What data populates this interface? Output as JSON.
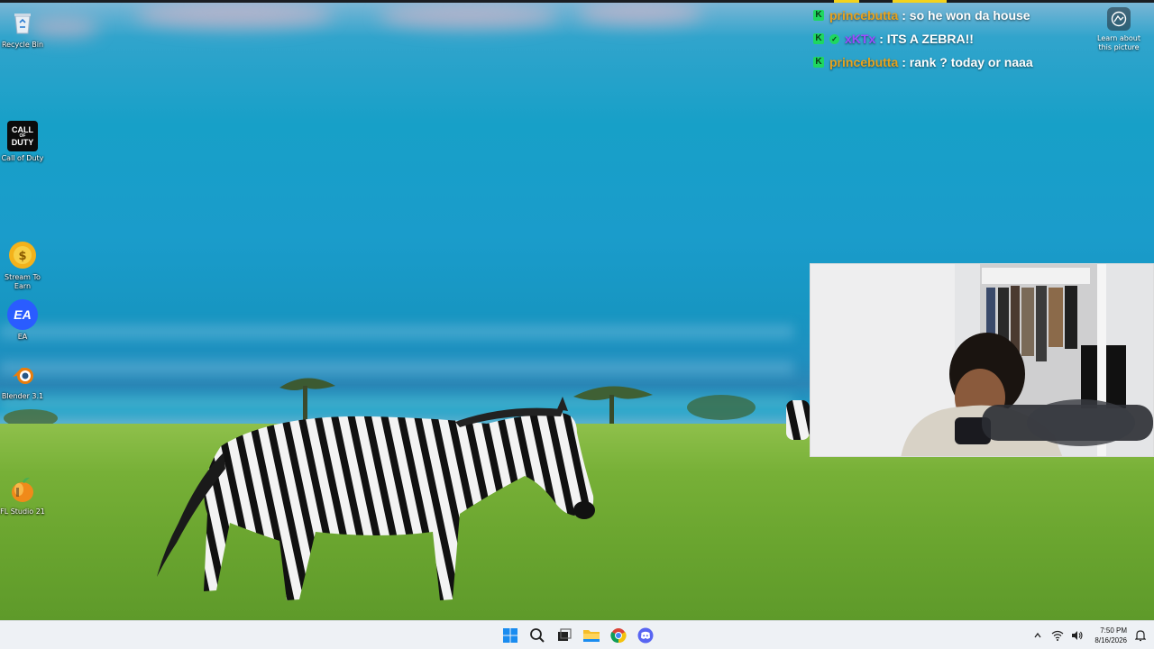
{
  "desktop": {
    "icons": [
      {
        "label": "Recycle Bin",
        "icon": "recycle-bin-icon"
      },
      {
        "label": "Call of Duty",
        "icon": "call-of-duty-icon"
      },
      {
        "label": "Stream To Earn",
        "icon": "stream-to-earn-icon"
      },
      {
        "label": "EA",
        "icon": "ea-icon"
      },
      {
        "label": "Blender 3.1",
        "icon": "blender-icon"
      },
      {
        "label": "FL Studio 21",
        "icon": "fl-studio-icon"
      }
    ],
    "cod_logo_line1": "CALL",
    "cod_logo_line2": "DUTY",
    "ea_logo": "EA",
    "learn_label": "Learn about this picture"
  },
  "chat": {
    "messages": [
      {
        "user": "princebutta",
        "user_color": "#e8a21c",
        "verified": false,
        "text": ": so he won da house"
      },
      {
        "user": "xKTx",
        "user_color": "#9b4dff",
        "verified": true,
        "text": ": ITS A ZEBRA!!"
      },
      {
        "user": "princebutta",
        "user_color": "#e8a21c",
        "verified": false,
        "text": ": rank ? today or naaa"
      }
    ],
    "badge_letter": "K"
  },
  "taskbar": {
    "apps": [
      "start-icon",
      "search-icon",
      "task-view-icon",
      "file-explorer-icon",
      "chrome-icon",
      "discord-icon"
    ],
    "time": "7:50 PM",
    "date": "8/16/2026"
  },
  "colors": {
    "accent": "#0078d4",
    "chat_badge": "#1ed760"
  }
}
